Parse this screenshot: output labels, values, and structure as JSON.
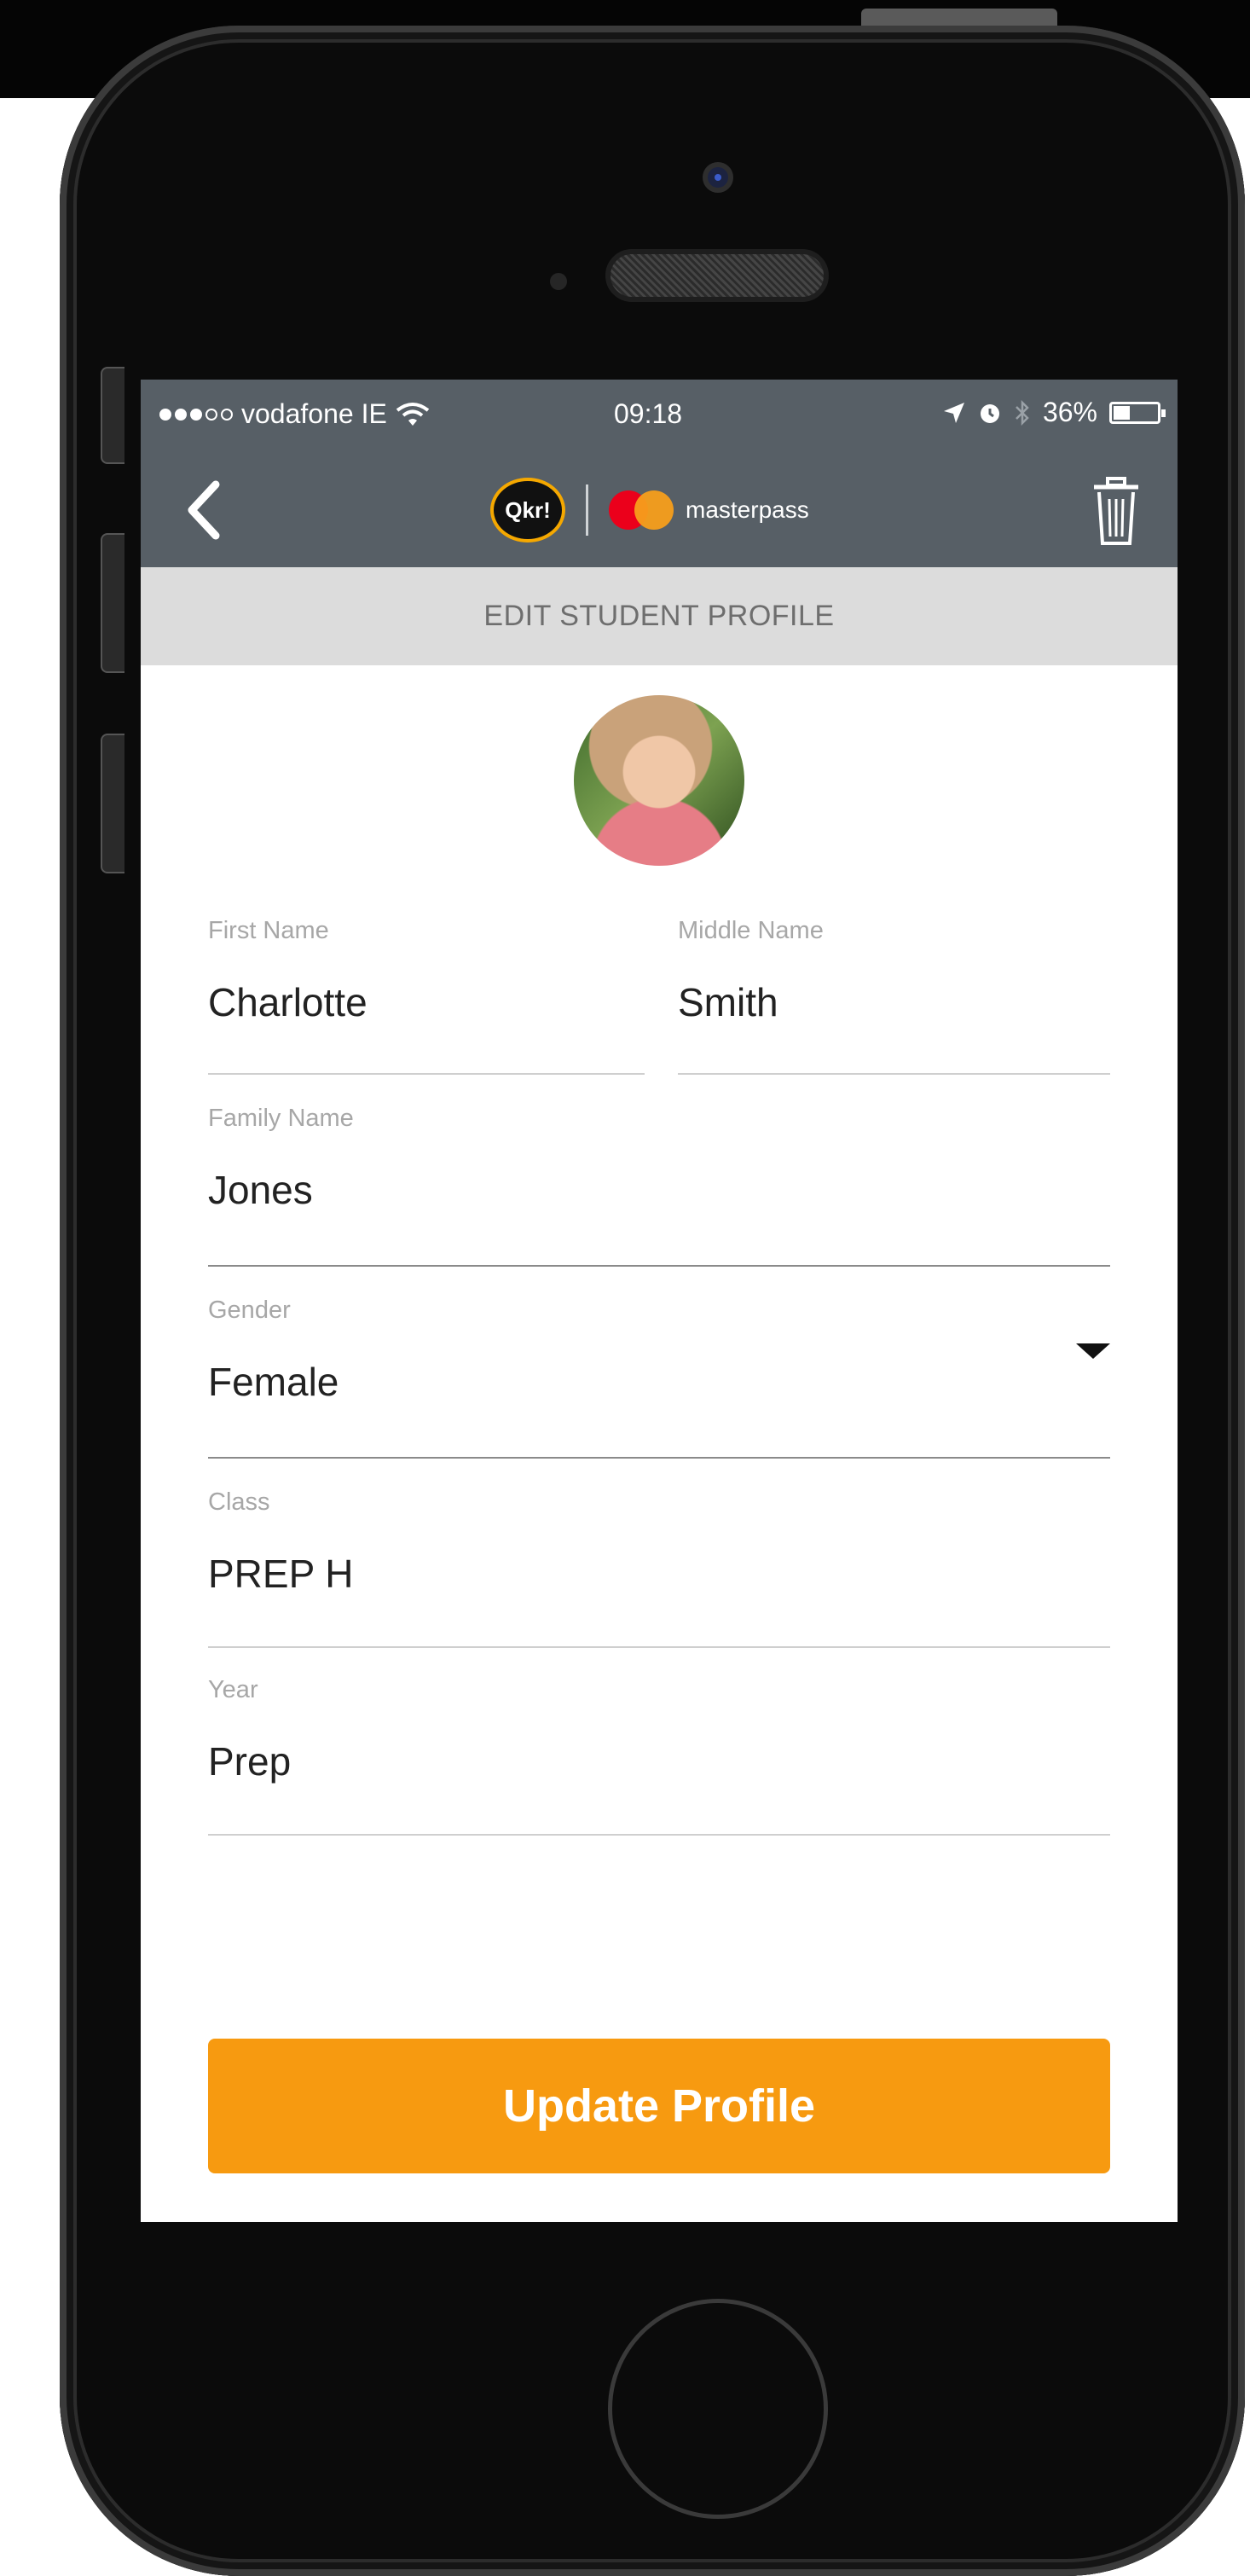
{
  "status_bar": {
    "signal_dots_filled": 3,
    "signal_dots_total": 5,
    "carrier": "vodafone IE",
    "time": "09:18",
    "battery": "36%",
    "battery_level": 0.36,
    "icons": [
      "wifi-icon",
      "location-arrow-icon",
      "alarm-icon",
      "bluetooth-icon",
      "battery-icon"
    ]
  },
  "nav": {
    "qkr_logo": "Qkr!",
    "masterpass_label": "masterpass",
    "icons": [
      "chevron-left-icon",
      "trash-icon"
    ]
  },
  "header": {
    "title": "EDIT STUDENT PROFILE"
  },
  "form": {
    "first_name": {
      "label": "First Name",
      "value": "Charlotte"
    },
    "middle_name": {
      "label": "Middle Name",
      "value": "Smith"
    },
    "family_name": {
      "label": "Family Name",
      "value": "Jones"
    },
    "gender": {
      "label": "Gender",
      "value": "Female"
    },
    "class": {
      "label": "Class",
      "value": "PREP H"
    },
    "year": {
      "label": "Year",
      "value": "Prep"
    }
  },
  "actions": {
    "update_label": "Update Profile"
  },
  "colors": {
    "nav_background": "#575f66",
    "header_background": "#dcdcdc",
    "accent": "#f79a10",
    "qkr_ring": "#f5a800",
    "mastercard_red": "#eb001b",
    "mastercard_orange": "#f79e1b"
  }
}
